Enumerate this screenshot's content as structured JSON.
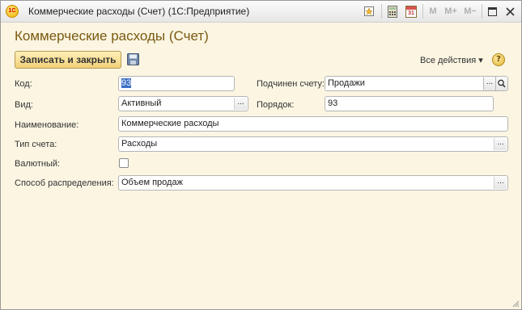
{
  "window": {
    "title": "Коммерческие расходы (Счет)  (1С:Предприятие)",
    "app_icon_text": "1С",
    "toolbar": {
      "mem_labels": [
        "M",
        "M+",
        "M−"
      ],
      "calendar_day": "31"
    }
  },
  "form": {
    "heading": "Коммерческие расходы (Счет)",
    "save_close_label": "Записать и закрыть",
    "all_actions_label": "Все действия ▾",
    "help_label": "?"
  },
  "fields": {
    "code": {
      "label": "Код:",
      "value": "93"
    },
    "parent": {
      "label": "Подчинен счету:",
      "value": "Продажи"
    },
    "kind": {
      "label": "Вид:",
      "value": "Активный"
    },
    "order": {
      "label": "Порядок:",
      "value": "93"
    },
    "name": {
      "label": "Наименование:",
      "value": "Коммерческие расходы"
    },
    "account_type": {
      "label": "Тип счета:",
      "value": "Расходы"
    },
    "currency": {
      "label": "Валютный:",
      "checked": false
    },
    "distribution": {
      "label": "Способ распределения:",
      "value": "Объем продаж"
    }
  },
  "button_glyphs": {
    "ellipsis": "..."
  }
}
